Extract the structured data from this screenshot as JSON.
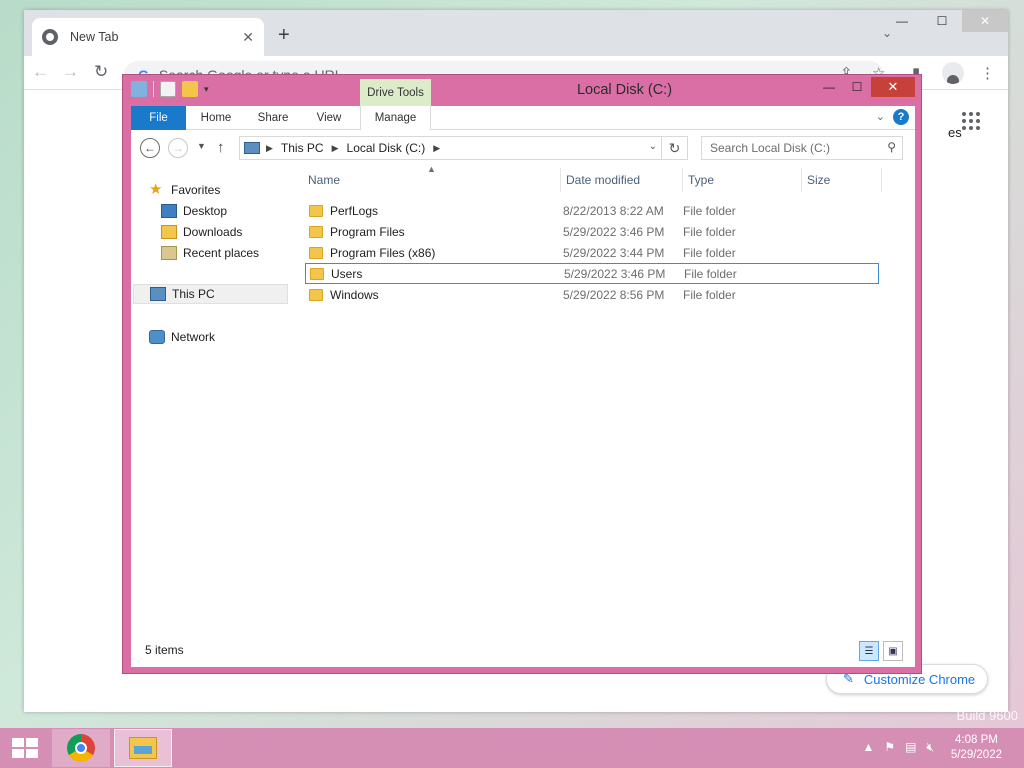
{
  "chrome": {
    "tab_title": "New Tab",
    "omnibox_placeholder": "Search Google or type a URL",
    "partial_shortcut_label": "es",
    "customize_label": "Customize Chrome"
  },
  "explorer": {
    "title": "Local Disk (C:)",
    "contextual_tab": "Drive Tools",
    "ribbon_tabs": [
      "File",
      "Home",
      "Share",
      "View",
      "Manage"
    ],
    "breadcrumb": [
      "This PC",
      "Local Disk (C:)"
    ],
    "search_placeholder": "Search Local Disk (C:)",
    "nav": {
      "favorites": "Favorites",
      "desktop": "Desktop",
      "downloads": "Downloads",
      "recent": "Recent places",
      "this_pc": "This PC",
      "network": "Network"
    },
    "columns": [
      "Name",
      "Date modified",
      "Type",
      "Size"
    ],
    "rows": [
      {
        "name": "PerfLogs",
        "date": "8/22/2013 8:22 AM",
        "type": "File folder"
      },
      {
        "name": "Program Files",
        "date": "5/29/2022 3:46 PM",
        "type": "File folder"
      },
      {
        "name": "Program Files (x86)",
        "date": "5/29/2022 3:44 PM",
        "type": "File folder"
      },
      {
        "name": "Users",
        "date": "5/29/2022 3:46 PM",
        "type": "File folder"
      },
      {
        "name": "Windows",
        "date": "5/29/2022 8:56 PM",
        "type": "File folder"
      }
    ],
    "status": "5 items"
  },
  "watermark": {
    "line1": "Build 9600"
  },
  "taskbar": {
    "time": "4:08 PM",
    "date": "5/29/2022"
  }
}
